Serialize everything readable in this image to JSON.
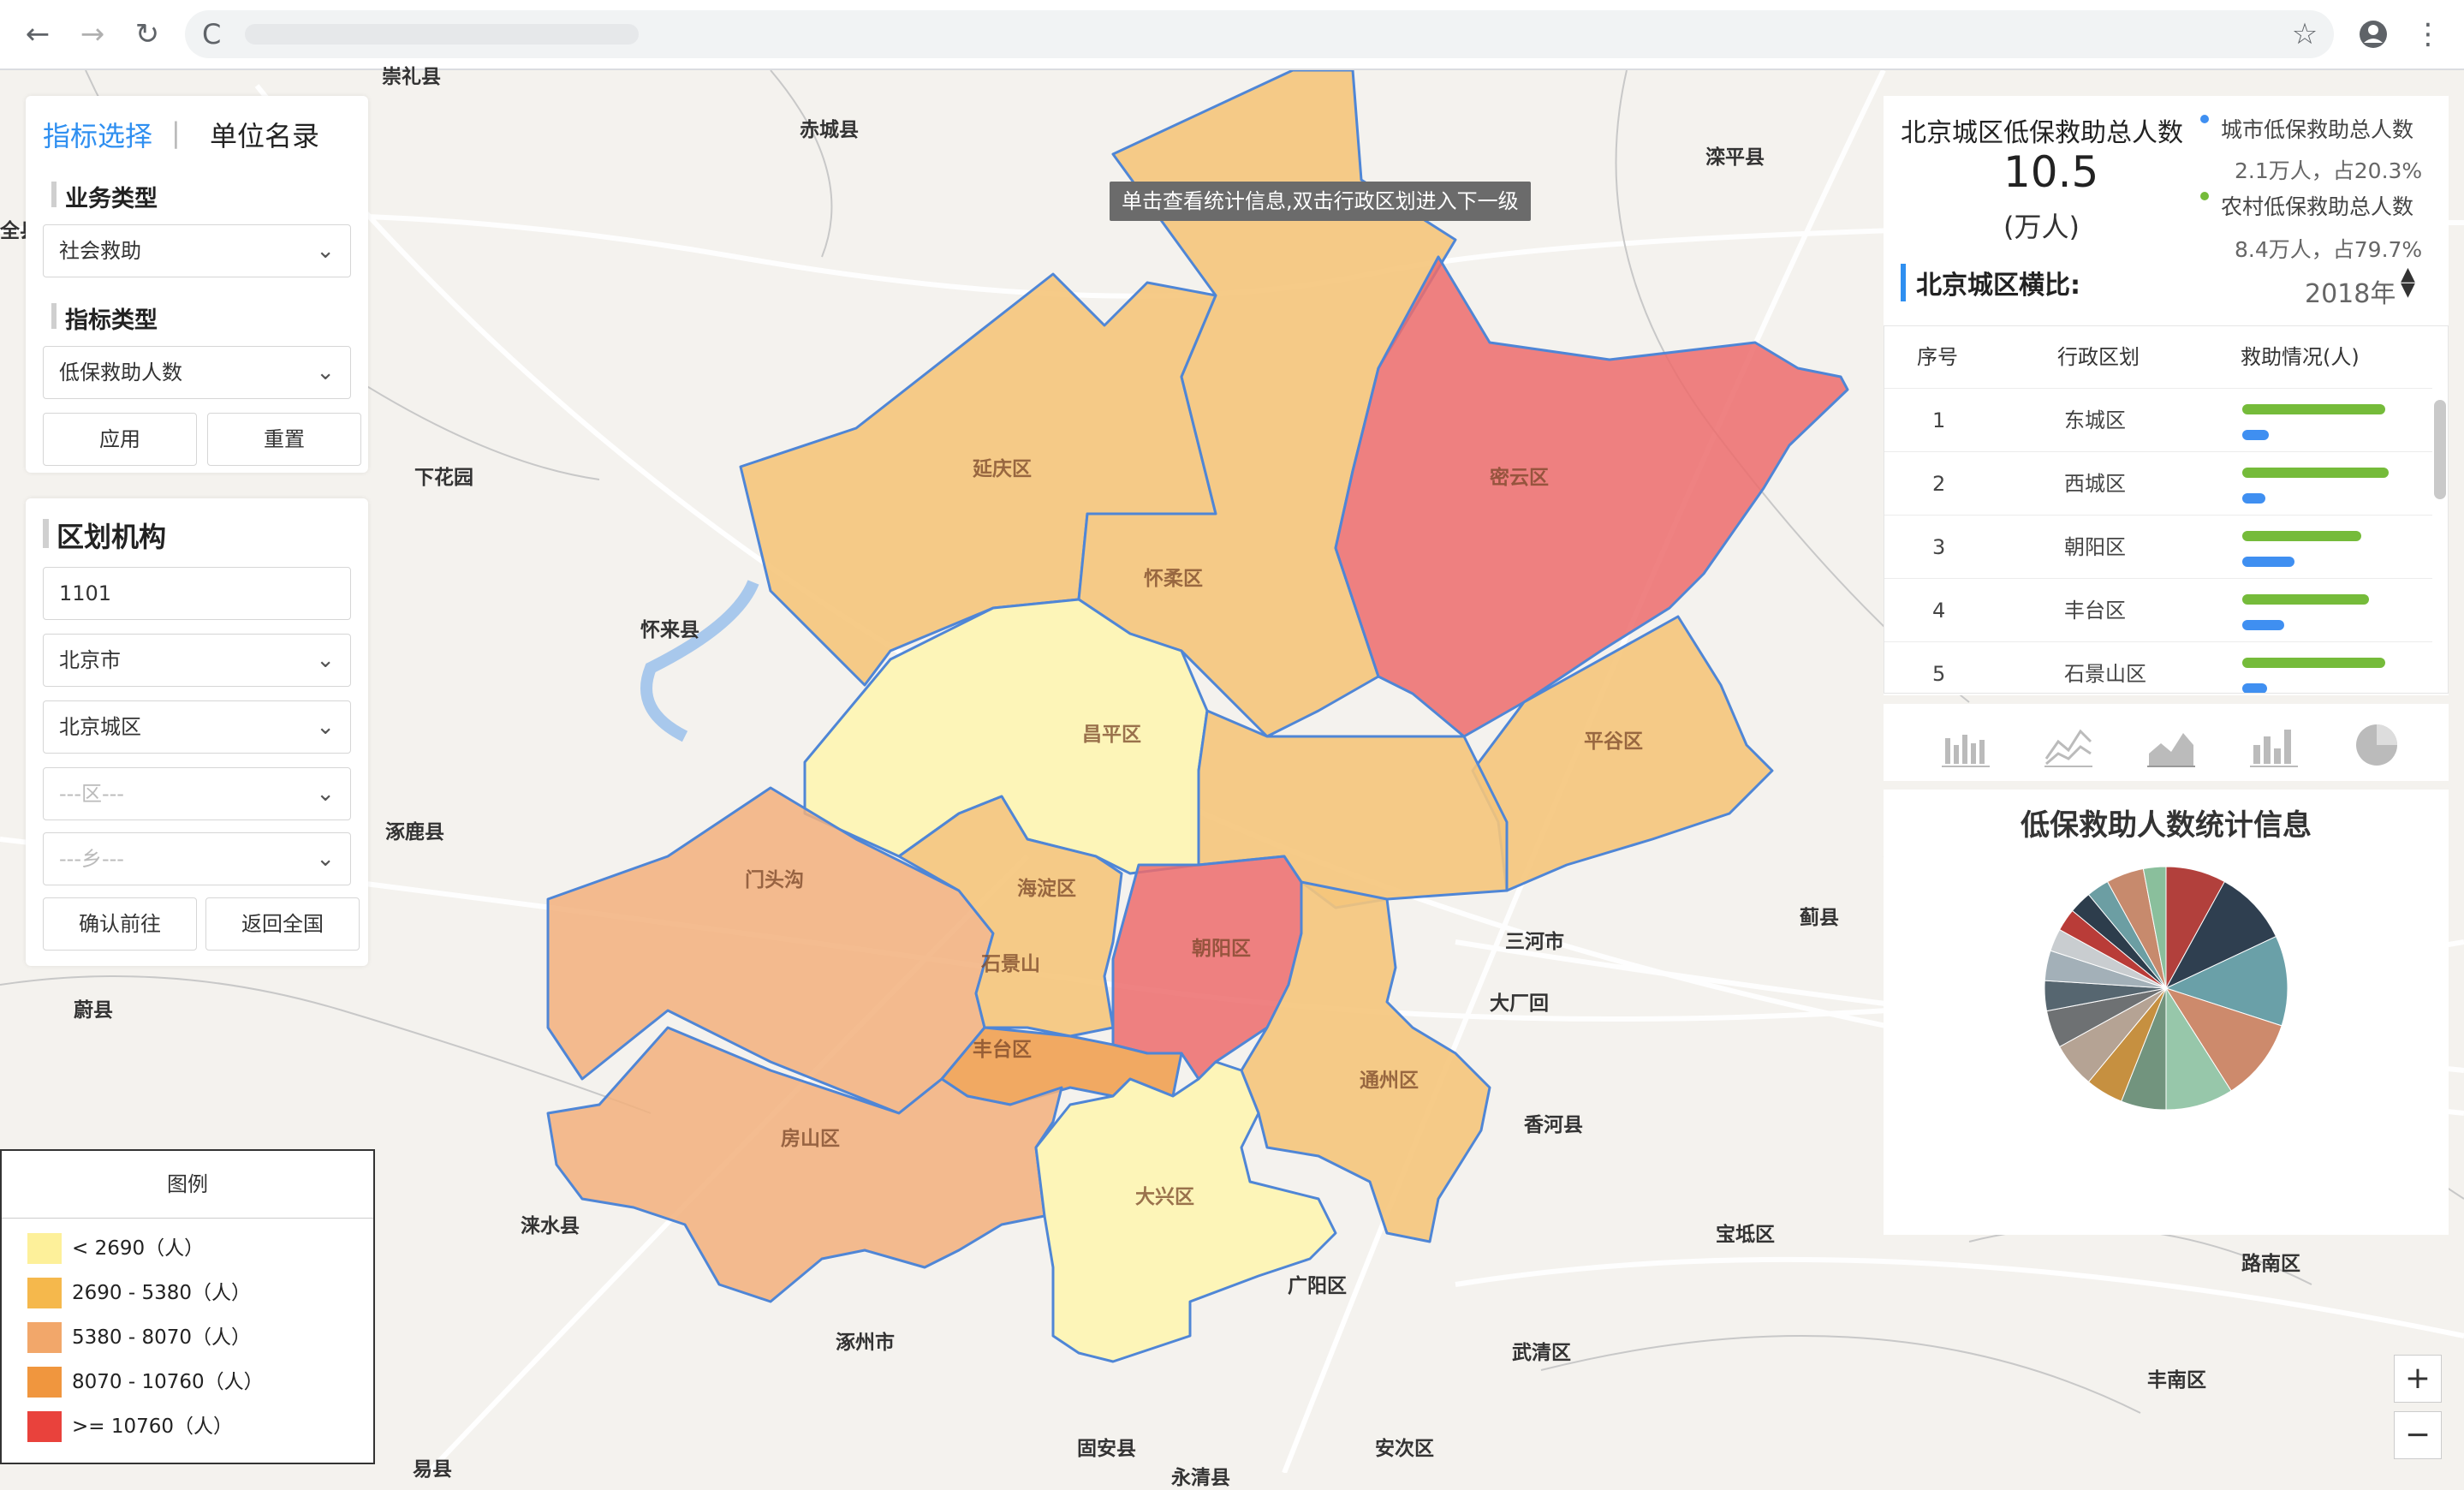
{
  "browser": {
    "reload_label": "C"
  },
  "map": {
    "tooltip": "单击查看统计信息,双击行政区划进入下一级",
    "places": [
      {
        "name": "崇礼县",
        "key": "chongli"
      },
      {
        "name": "赤城县",
        "key": "chicheng"
      },
      {
        "name": "滦平县",
        "key": "luanping"
      },
      {
        "name": "全县",
        "key": "quanxian"
      },
      {
        "name": "下花园",
        "key": "xiahuayuan"
      },
      {
        "name": "怀来县",
        "key": "huailai"
      },
      {
        "name": "涿鹿县",
        "key": "zhuolu"
      },
      {
        "name": "蓟县",
        "key": "jixian"
      },
      {
        "name": "三河市",
        "key": "sanhe"
      },
      {
        "name": "大厂回",
        "key": "dachang"
      },
      {
        "name": "香河县",
        "key": "xianghe"
      },
      {
        "name": "蔚县",
        "key": "yuxian"
      },
      {
        "name": "涞水县",
        "key": "laishui"
      },
      {
        "name": "宝坻区",
        "key": "baodi"
      },
      {
        "name": "路南区",
        "key": "lunan"
      },
      {
        "name": "广阳区",
        "key": "guangyang"
      },
      {
        "name": "武清区",
        "key": "wuqing"
      },
      {
        "name": "涿州市",
        "key": "zhuozhou"
      },
      {
        "name": "丰南区",
        "key": "fengnan"
      },
      {
        "name": "固安县",
        "key": "guan"
      },
      {
        "name": "安次区",
        "key": "anci"
      },
      {
        "name": "易县",
        "key": "yixian"
      },
      {
        "name": "永清县",
        "key": "yongqing"
      }
    ],
    "districts": {
      "yanqing": "延庆区",
      "huairou": "怀柔区",
      "miyun": "密云区",
      "changping": "昌平区",
      "pinggu": "平谷区",
      "mentougou": "门头沟",
      "haidian": "海淀区",
      "shijingshan": "石景山",
      "chaoyang": "朝阳区",
      "fengtai": "丰台区",
      "tongzhou": "通州区",
      "fangshan": "房山区",
      "daxing": "大兴区"
    }
  },
  "indicator_panel": {
    "tab_active": "指标选择",
    "tab_separator": "|",
    "tab_inactive": "单位名录",
    "business_type_label": "业务类型",
    "business_type_value": "社会救助",
    "indicator_type_label": "指标类型",
    "indicator_type_value": "低保救助人数",
    "apply_label": "应用",
    "reset_label": "重置"
  },
  "org_panel": {
    "title": "区划机构",
    "code_value": "1101",
    "city_value": "北京市",
    "area_value": "北京城区",
    "district_placeholder": "---区---",
    "township_placeholder": "---乡---",
    "confirm_label": "确认前往",
    "return_label": "返回全国"
  },
  "legend": {
    "title": "图例",
    "items": [
      {
        "label": "< 2690（人）",
        "color": "#fdf09a"
      },
      {
        "label": "2690 - 5380（人）",
        "color": "#f5b84c"
      },
      {
        "label": "5380 - 8070（人）",
        "color": "#f2a76a"
      },
      {
        "label": "8070 - 10760（人）",
        "color": "#f0963e"
      },
      {
        "label": ">= 10760（人）",
        "color": "#e9423c"
      }
    ]
  },
  "summary": {
    "title": "北京城区低保救助总人数",
    "value": "10.5",
    "unit": "(万人)",
    "urban_label": "城市低保救助总人数",
    "urban_detail": "2.1万人，占20.3%",
    "urban_color": "#3f8ff1",
    "rural_label": "农村低保救助总人数",
    "rural_detail": "8.4万人，占79.7%",
    "rural_color": "#75bb3a",
    "compare_title": "北京城区横比:",
    "year": "2018年"
  },
  "table": {
    "headers": {
      "index": "序号",
      "region": "行政区划",
      "aid": "救助情况(人)"
    },
    "rows": [
      {
        "index": "1",
        "region": "东城区",
        "rural": 0.93,
        "urban": 0.17
      },
      {
        "index": "2",
        "region": "西城区",
        "rural": 0.95,
        "urban": 0.15
      },
      {
        "index": "3",
        "region": "朝阳区",
        "rural": 0.77,
        "urban": 0.34
      },
      {
        "index": "4",
        "region": "丰台区",
        "rural": 0.82,
        "urban": 0.27
      },
      {
        "index": "5",
        "region": "石景山区",
        "rural": 0.93,
        "urban": 0.16
      }
    ]
  },
  "chart_icons": [
    "bar-chart-icon",
    "line-chart-icon",
    "area-chart-icon",
    "stacked-bar-chart-icon",
    "pie-chart-icon"
  ],
  "chart_data": {
    "type": "pie",
    "title": "低保救助人数统计信息",
    "values": [
      8,
      10,
      12,
      11,
      9,
      6,
      5,
      6,
      5,
      4,
      4,
      3,
      3,
      3,
      3,
      5,
      3
    ],
    "colors": [
      "#b2403c",
      "#2f3f50",
      "#6aa0a8",
      "#cd8a6c",
      "#97c7aa",
      "#72947e",
      "#c69040",
      "#b5a394",
      "#6e7173",
      "#566670",
      "#a3b0b8",
      "#c9cdd0",
      "#b93c38",
      "#2d3d4c",
      "#6c9ea3",
      "#c78a6d",
      "#8abf9c"
    ]
  },
  "zoom": {
    "in": "+",
    "out": "−"
  }
}
